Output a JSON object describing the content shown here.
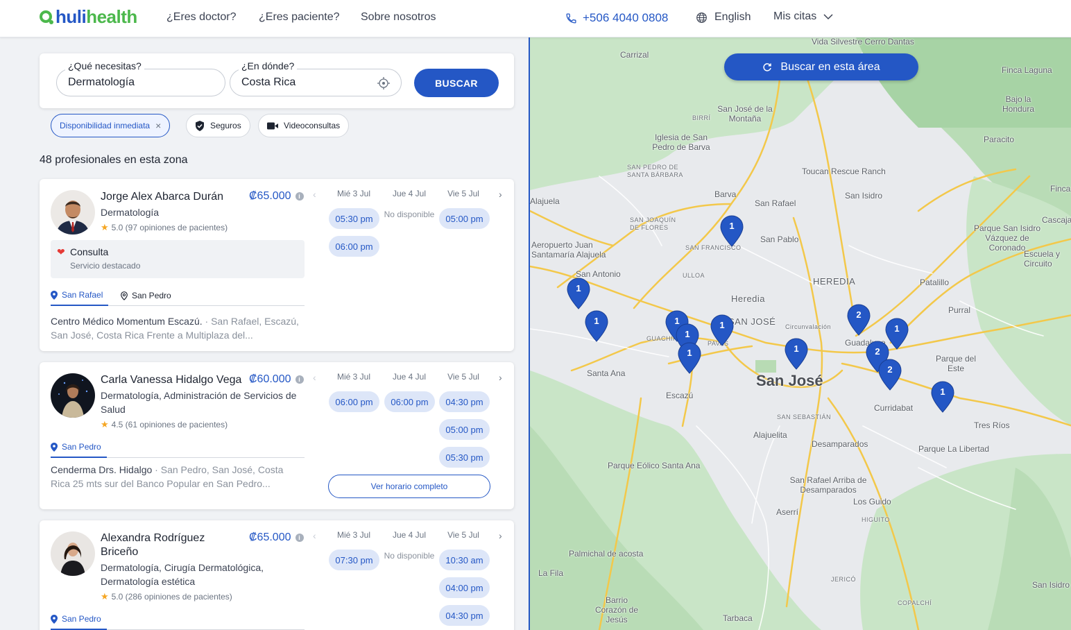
{
  "header": {
    "logo_a": "huli",
    "logo_b": "health",
    "nav": [
      "¿Eres doctor?",
      "¿Eres paciente?",
      "Sobre nosotros"
    ],
    "phone": "+506 4040 0808",
    "language": "English",
    "appointments": "Mis citas"
  },
  "search": {
    "what_label": "¿Qué necesitas?",
    "what_value": "Dermatología",
    "where_label": "¿En dónde?",
    "where_value": "Costa Rica",
    "button": "BUSCAR"
  },
  "filters": [
    "Disponibilidad inmediata",
    "Seguros",
    "Videoconsultas"
  ],
  "results_count": "48 profesionales en esta zona",
  "doctors": [
    {
      "name": "Jorge Alex Abarca Durán",
      "price": "₡65.000",
      "specialty": "Dermatología",
      "rating": "5.0 (97 opiniones de pacientes)",
      "featured_title": "Consulta",
      "featured_sub": "Servicio destacado",
      "locations": [
        "San Rafael",
        "San Pedro"
      ],
      "address_main": "Centro Médico Momentum Escazú.",
      "address_rest": " · San Rafael, Escazú, San José, Costa Rica Frente a Multiplaza del...",
      "days": [
        "Mié 3 Jul",
        "Jue 4 Jul",
        "Vie 5 Jul"
      ],
      "day1": [
        "05:30 pm",
        "06:00 pm"
      ],
      "day2_unavail": "No disponible",
      "day3": [
        "05:00 pm"
      ]
    },
    {
      "name": "Carla Vanessa Hidalgo Vega",
      "price": "₡60.000",
      "specialty": "Dermatología, Administración de Servicios de Salud",
      "rating": "4.5 (61 opiniones de pacientes)",
      "locations": [
        "San Pedro"
      ],
      "address_main": "Cenderma Drs. Hidalgo",
      "address_rest": " · San Pedro, San José, Costa Rica 25 mts sur del Banco Popular en San Pedro...",
      "days": [
        "Mié 3 Jul",
        "Jue 4 Jul",
        "Vie 5 Jul"
      ],
      "day1": [
        "06:00 pm"
      ],
      "day2": [
        "06:00 pm"
      ],
      "day3": [
        "04:30 pm",
        "05:00 pm",
        "05:30 pm"
      ],
      "full_schedule": "Ver horario completo"
    },
    {
      "name": "Alexandra Rodríguez Briceño",
      "price": "₡65.000",
      "specialty": "Dermatología, Cirugía Dermatológica, Dermatología estética",
      "rating": "5.0 (286 opiniones de pacientes)",
      "locations": [
        "San Pedro"
      ],
      "days": [
        "Mié 3 Jul",
        "Jue 4 Jul",
        "Vie 5 Jul"
      ],
      "day1": [
        "07:30 pm"
      ],
      "day2_unavail": "No disponible",
      "day3": [
        "10:30 am",
        "04:00 pm",
        "04:30 pm"
      ]
    }
  ],
  "map": {
    "search_area_button": "Buscar en esta área",
    "city_label": "San José",
    "labels": [
      "Vida Silvestre Cerro Dantas",
      "Carrizal",
      "Finca Laguna",
      "Bajo la Hondura",
      "San José de la Montaña",
      "Iglesia de San Pedro de Barva",
      "Paracito",
      "Toucan Rescue Ranch",
      "Barva",
      "San Rafael",
      "San Isidro",
      "Alajuela",
      "Aeropuerto Juan Santamaría Alajuela",
      "San Pablo",
      "Parque San Isidro Vázquez de Coronado",
      "San Antonio",
      "Heredia",
      "Patalillo",
      "Purral",
      "Santa Ana",
      "Escazú",
      "Guadalupe",
      "Parque del Este",
      "Curridabat",
      "Tres Ríos",
      "Alajuelita",
      "Desamparados",
      "Parque La Libertad",
      "Parque Eólico Santa Ana",
      "San Rafael Arriba de Desamparados",
      "Los Guido",
      "Aserrí",
      "Palmichal de acosta",
      "La Fila",
      "Barrio Corazón de Jesús",
      "Tarbaca",
      "San Isidro",
      "Escuela y Circuito",
      "Cascajal",
      "Finca"
    ],
    "small_labels": [
      "SAN PEDRO DE SANTA BÁRBARA",
      "SAN JOAQUÍN DE FLORES",
      "SAN FRANCISCO",
      "ULLOA",
      "HEREDIA",
      "SAN JOSÉ",
      "GUACHIPELÍN",
      "PAVAS",
      "SAN SEBASTIÁN",
      "HIGUITO",
      "JERICÓ",
      "COPALCHÍ",
      "BIRRÍ",
      "Circunvalación"
    ],
    "pins": [
      "1",
      "1",
      "1",
      "1",
      "1",
      "1",
      "1",
      "1",
      "2",
      "1",
      "2",
      "2",
      "1"
    ]
  }
}
